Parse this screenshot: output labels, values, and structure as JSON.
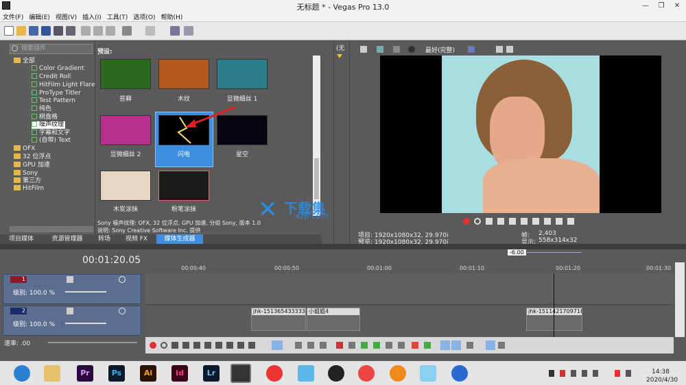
{
  "window": {
    "title": "无标题 * - Vegas Pro 13.0"
  },
  "menu": [
    "文件(F)",
    "编辑(E)",
    "视图(V)",
    "插入(I)",
    "工具(T)",
    "选项(O)",
    "帮助(H)"
  ],
  "plugins": {
    "search_placeholder": "搜索插件",
    "root": "全部",
    "items": [
      "Color Gradient",
      "Credit Roll",
      "HitFilm Light Flares",
      "ProType Titler",
      "Test Pattern",
      "纯色",
      "棋盘格",
      "噪声纹理",
      "字幕和文字",
      "(自带) Text"
    ],
    "groups": [
      "OFX",
      "32 位浮点",
      "GPU 加速",
      "Sony",
      "第三方",
      "HitFilm"
    ]
  },
  "presets": {
    "header": "预设:",
    "items": [
      {
        "label": "苔藓",
        "color": "#2e6a1e"
      },
      {
        "label": "木纹",
        "color": "#b3581e"
      },
      {
        "label": "显微细丝 1",
        "color": "#2a7f8a"
      },
      {
        "label": "显微细丝 2",
        "color": "#b8308c"
      },
      {
        "label": "闪电",
        "color": "#000000"
      },
      {
        "label": "星空",
        "color": "#050510"
      },
      {
        "label": "木炭涂抹",
        "color": "#e8d6c4"
      },
      {
        "label": "粉笔涂抹",
        "color": "#1a1a1a"
      }
    ],
    "desc1": "Sony 噪声纹理: OFX, 32 位浮点, GPU 加速, 分组 Sony, 版本 1.0",
    "desc2": "说明: Sony Creative Software Inc. 提供"
  },
  "tabs": [
    "项目媒体",
    "资源管理器",
    "转场",
    "视频 FX",
    "媒体生成器"
  ],
  "preview": {
    "quality": "最好(完整)",
    "project": "项目: 1920x1080x32, 29.970i",
    "preview_info": "预览: 1920x1080x32, 29.970i",
    "frame_label": "帧:",
    "frame_value": "2,403",
    "display_label": "显示:",
    "display_value": "558x314x32",
    "side_label": "(无"
  },
  "watermark": {
    "text": "下载集",
    "sub": "xzji.com"
  },
  "timeline": {
    "time": "00:01:20.05",
    "marker": "-6.00",
    "ruler": [
      "00:00:40",
      "00:00:50",
      "00:01:00",
      "00:01:10",
      "00:01:20",
      "00:01:30"
    ],
    "tracks": [
      {
        "num": "1",
        "level": "级别: 100.0 %"
      },
      {
        "num": "2",
        "level": "级别: 100.0 %"
      }
    ],
    "rate": "速率: .00",
    "clips": [
      "jhk-1513654333339",
      "小姐姐4",
      "jhk-1511421709718"
    ]
  },
  "taskbar": {
    "apps": [
      "Pr",
      "Ps",
      "Ai",
      "Id",
      "Lr"
    ],
    "time": "14:38",
    "date": "2020/4/30"
  },
  "colors": {
    "selection": "#3d8ee0",
    "track": "#5b6e90"
  }
}
